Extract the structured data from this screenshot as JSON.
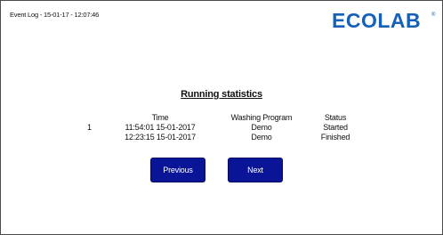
{
  "header": {
    "title": "Event Log - 15-01-17 - 12:07:46",
    "logo_text": "ECOLAB",
    "logo_mark": "®",
    "logo_color": "#1560b8"
  },
  "statistics": {
    "title": "Running statistics",
    "columns": [
      "Time",
      "Washing Program",
      "Status"
    ],
    "rows": [
      {
        "index": "1",
        "time": "11:54:01 15-01-2017",
        "program": "Demo",
        "status": "Started"
      },
      {
        "index": "",
        "time": "12:23:15 15-01-2017",
        "program": "Demo",
        "status": "Finished"
      }
    ]
  },
  "buttons": {
    "previous": "Previous",
    "next": "Next",
    "color": "#0a1496"
  }
}
